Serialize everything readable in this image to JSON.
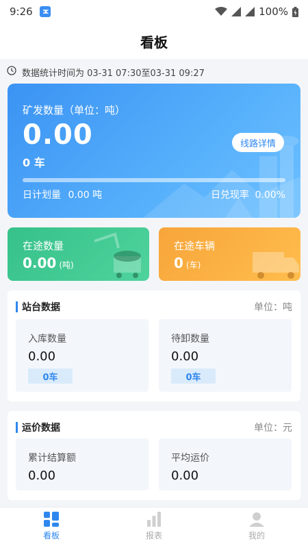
{
  "status": {
    "time": "9:26",
    "battery": "100%"
  },
  "header": {
    "title": "看板"
  },
  "stat_time": {
    "text": "数据统计时间为 03-31 07:30至03-31 09:27"
  },
  "main_card": {
    "label": "矿发数量（单位：吨）",
    "value": "0.00",
    "cars": "0 车",
    "route_button": "线路详情",
    "progress": 0,
    "plan_label": "日计划量",
    "plan_value": "0.00 吨",
    "rate_label": "日兑现率",
    "rate_value": "0.00%"
  },
  "in_transit": {
    "title": "在途数量",
    "value": "0.00",
    "unit": "(吨)"
  },
  "vehicles": {
    "title": "在途车辆",
    "value": "0",
    "unit": "(车)"
  },
  "station": {
    "title": "站台数据",
    "unit": "单位：吨",
    "cells": [
      {
        "label": "入库数量",
        "value": "0.00",
        "badge": "0车"
      },
      {
        "label": "待卸数量",
        "value": "0.00",
        "badge": "0车"
      }
    ]
  },
  "price": {
    "title": "运价数据",
    "unit": "单位：元",
    "cells": [
      {
        "label": "累计结算额",
        "value": "0.00"
      },
      {
        "label": "平均运价",
        "value": "0.00"
      }
    ]
  },
  "tabs": [
    {
      "label": "看板",
      "icon": "dashboard-icon",
      "active": true
    },
    {
      "label": "报表",
      "icon": "bar-chart-icon",
      "active": false
    },
    {
      "label": "我的",
      "icon": "user-icon",
      "active": false
    }
  ],
  "colors": {
    "accent": "#2f87ee",
    "green_card": "#36c18a",
    "orange_card": "#f7a53a"
  }
}
